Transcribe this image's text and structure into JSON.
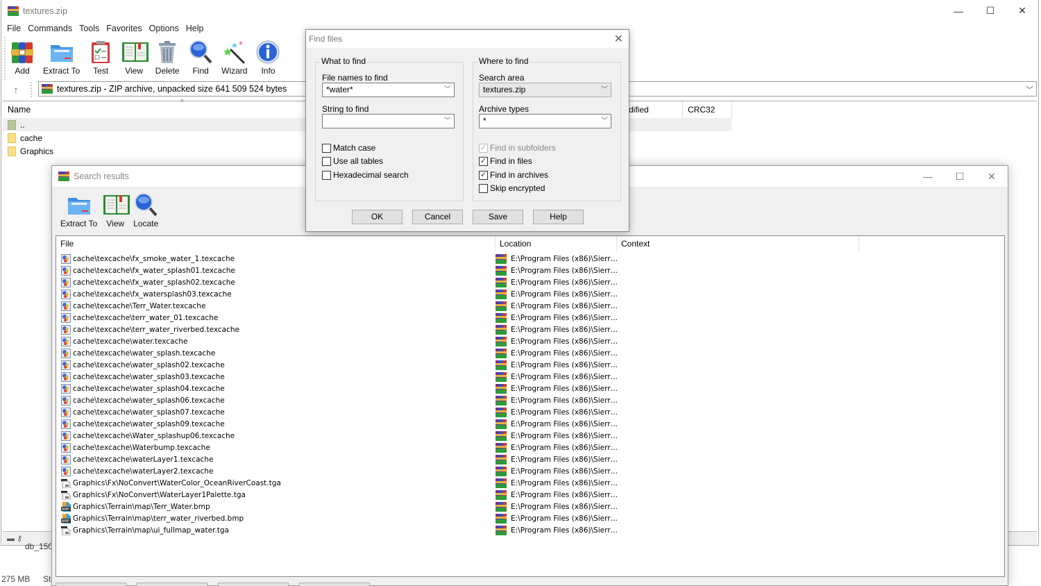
{
  "main_window": {
    "title": "textures.zip",
    "controls": {
      "minimize": "—",
      "maximize": "☐",
      "close": "✕"
    },
    "menu": [
      "File",
      "Commands",
      "Tools",
      "Favorites",
      "Options",
      "Help"
    ],
    "toolbar": [
      {
        "label": "Add",
        "icon": "add-archive-icon"
      },
      {
        "label": "Extract To",
        "icon": "extract-folder-icon"
      },
      {
        "label": "Test",
        "icon": "test-clipboard-icon"
      },
      {
        "label": "View",
        "icon": "view-book-icon"
      },
      {
        "label": "Delete",
        "icon": "delete-trash-icon"
      },
      {
        "label": "Find",
        "icon": "find-magnifier-icon"
      },
      {
        "label": "Wizard",
        "icon": "wizard-wand-icon"
      },
      {
        "label": "Info",
        "icon": "info-icon"
      }
    ],
    "address": {
      "up_arrow": "↑",
      "text": "textures.zip - ZIP archive, unpacked size 641 509 524 bytes"
    },
    "file_list": {
      "columns": {
        "name": "Name",
        "modified": "dified",
        "crc": "CRC32"
      },
      "rows": [
        {
          "name": "..",
          "type": "parent"
        },
        {
          "name": "cache",
          "type": "folder"
        },
        {
          "name": "Graphics",
          "type": "folder"
        }
      ]
    },
    "status": {
      "size_text": "275 MB",
      "partial_text": "Sta",
      "background_item": "db_150"
    }
  },
  "find_dialog": {
    "title": "Find files",
    "close": "✕",
    "what_group": {
      "legend": "What to find",
      "file_names_label": "File names to find",
      "file_names_value": "*water*",
      "string_label": "String to find",
      "string_value": "",
      "checkboxes": [
        {
          "label": "Match case",
          "checked": false,
          "enabled": true
        },
        {
          "label": "Use all tables",
          "checked": false,
          "enabled": true
        },
        {
          "label": "Hexadecimal search",
          "checked": false,
          "enabled": true
        }
      ]
    },
    "where_group": {
      "legend": "Where to find",
      "search_area_label": "Search area",
      "search_area_value": "textures.zip",
      "archive_types_label": "Archive types",
      "archive_types_value": "*",
      "checkboxes": [
        {
          "label": "Find in subfolders",
          "checked": true,
          "enabled": false
        },
        {
          "label": "Find in files",
          "checked": true,
          "enabled": true
        },
        {
          "label": "Find in archives",
          "checked": true,
          "enabled": true
        },
        {
          "label": "Skip encrypted",
          "checked": false,
          "enabled": true
        }
      ]
    },
    "buttons": {
      "ok": "OK",
      "cancel": "Cancel",
      "save": "Save",
      "help": "Help"
    }
  },
  "search_results": {
    "title": "Search results",
    "controls": {
      "minimize": "—",
      "maximize": "☐",
      "close": "✕"
    },
    "toolbar": [
      {
        "label": "Extract To",
        "icon": "extract-folder-icon"
      },
      {
        "label": "View",
        "icon": "view-book-icon"
      },
      {
        "label": "Locate",
        "icon": "locate-magnifier-icon"
      }
    ],
    "columns": {
      "file": "File",
      "location": "Location",
      "context": "Context"
    },
    "rows": [
      {
        "file": "cache\\texcache\\fx_smoke_water_1.texcache",
        "type": "texcache",
        "location": "E:\\Program Files (x86)\\Sierr…",
        "context": ""
      },
      {
        "file": "cache\\texcache\\fx_water_splash01.texcache",
        "type": "texcache",
        "location": "E:\\Program Files (x86)\\Sierr…",
        "context": ""
      },
      {
        "file": "cache\\texcache\\fx_water_splash02.texcache",
        "type": "texcache",
        "location": "E:\\Program Files (x86)\\Sierr…",
        "context": ""
      },
      {
        "file": "cache\\texcache\\fx_watersplash03.texcache",
        "type": "texcache",
        "location": "E:\\Program Files (x86)\\Sierr…",
        "context": ""
      },
      {
        "file": "cache\\texcache\\Terr_Water.texcache",
        "type": "texcache",
        "location": "E:\\Program Files (x86)\\Sierr…",
        "context": ""
      },
      {
        "file": "cache\\texcache\\terr_water_01.texcache",
        "type": "texcache",
        "location": "E:\\Program Files (x86)\\Sierr…",
        "context": ""
      },
      {
        "file": "cache\\texcache\\terr_water_riverbed.texcache",
        "type": "texcache",
        "location": "E:\\Program Files (x86)\\Sierr…",
        "context": ""
      },
      {
        "file": "cache\\texcache\\water.texcache",
        "type": "texcache",
        "location": "E:\\Program Files (x86)\\Sierr…",
        "context": ""
      },
      {
        "file": "cache\\texcache\\water_splash.texcache",
        "type": "texcache",
        "location": "E:\\Program Files (x86)\\Sierr…",
        "context": ""
      },
      {
        "file": "cache\\texcache\\water_splash02.texcache",
        "type": "texcache",
        "location": "E:\\Program Files (x86)\\Sierr…",
        "context": ""
      },
      {
        "file": "cache\\texcache\\water_splash03.texcache",
        "type": "texcache",
        "location": "E:\\Program Files (x86)\\Sierr…",
        "context": ""
      },
      {
        "file": "cache\\texcache\\water_splash04.texcache",
        "type": "texcache",
        "location": "E:\\Program Files (x86)\\Sierr…",
        "context": ""
      },
      {
        "file": "cache\\texcache\\water_splash06.texcache",
        "type": "texcache",
        "location": "E:\\Program Files (x86)\\Sierr…",
        "context": ""
      },
      {
        "file": "cache\\texcache\\water_splash07.texcache",
        "type": "texcache",
        "location": "E:\\Program Files (x86)\\Sierr…",
        "context": ""
      },
      {
        "file": "cache\\texcache\\water_splash09.texcache",
        "type": "texcache",
        "location": "E:\\Program Files (x86)\\Sierr…",
        "context": ""
      },
      {
        "file": "cache\\texcache\\Water_splashup06.texcache",
        "type": "texcache",
        "location": "E:\\Program Files (x86)\\Sierr…",
        "context": ""
      },
      {
        "file": "cache\\texcache\\Waterbump.texcache",
        "type": "texcache",
        "location": "E:\\Program Files (x86)\\Sierr…",
        "context": ""
      },
      {
        "file": "cache\\texcache\\waterLayer1.texcache",
        "type": "texcache",
        "location": "E:\\Program Files (x86)\\Sierr…",
        "context": ""
      },
      {
        "file": "cache\\texcache\\waterLayer2.texcache",
        "type": "texcache",
        "location": "E:\\Program Files (x86)\\Sierr…",
        "context": ""
      },
      {
        "file": "Graphics\\Fx\\NoConvert\\WaterColor_OceanRiverCoast.tga",
        "type": "tga",
        "location": "E:\\Program Files (x86)\\Sierr…",
        "context": ""
      },
      {
        "file": "Graphics\\Fx\\NoConvert\\WaterLayer1Palette.tga",
        "type": "tga",
        "location": "E:\\Program Files (x86)\\Sierr…",
        "context": ""
      },
      {
        "file": "Graphics\\Terrain\\map\\Terr_Water.bmp",
        "type": "bmp",
        "location": "E:\\Program Files (x86)\\Sierr…",
        "context": ""
      },
      {
        "file": "Graphics\\Terrain\\map\\terr_water_riverbed.bmp",
        "type": "bmp",
        "location": "E:\\Program Files (x86)\\Sierr…",
        "context": ""
      },
      {
        "file": "Graphics\\Terrain\\map\\ui_fullmap_water.tga",
        "type": "tga",
        "location": "E:\\Program Files (x86)\\Sierr…",
        "context": ""
      }
    ]
  }
}
